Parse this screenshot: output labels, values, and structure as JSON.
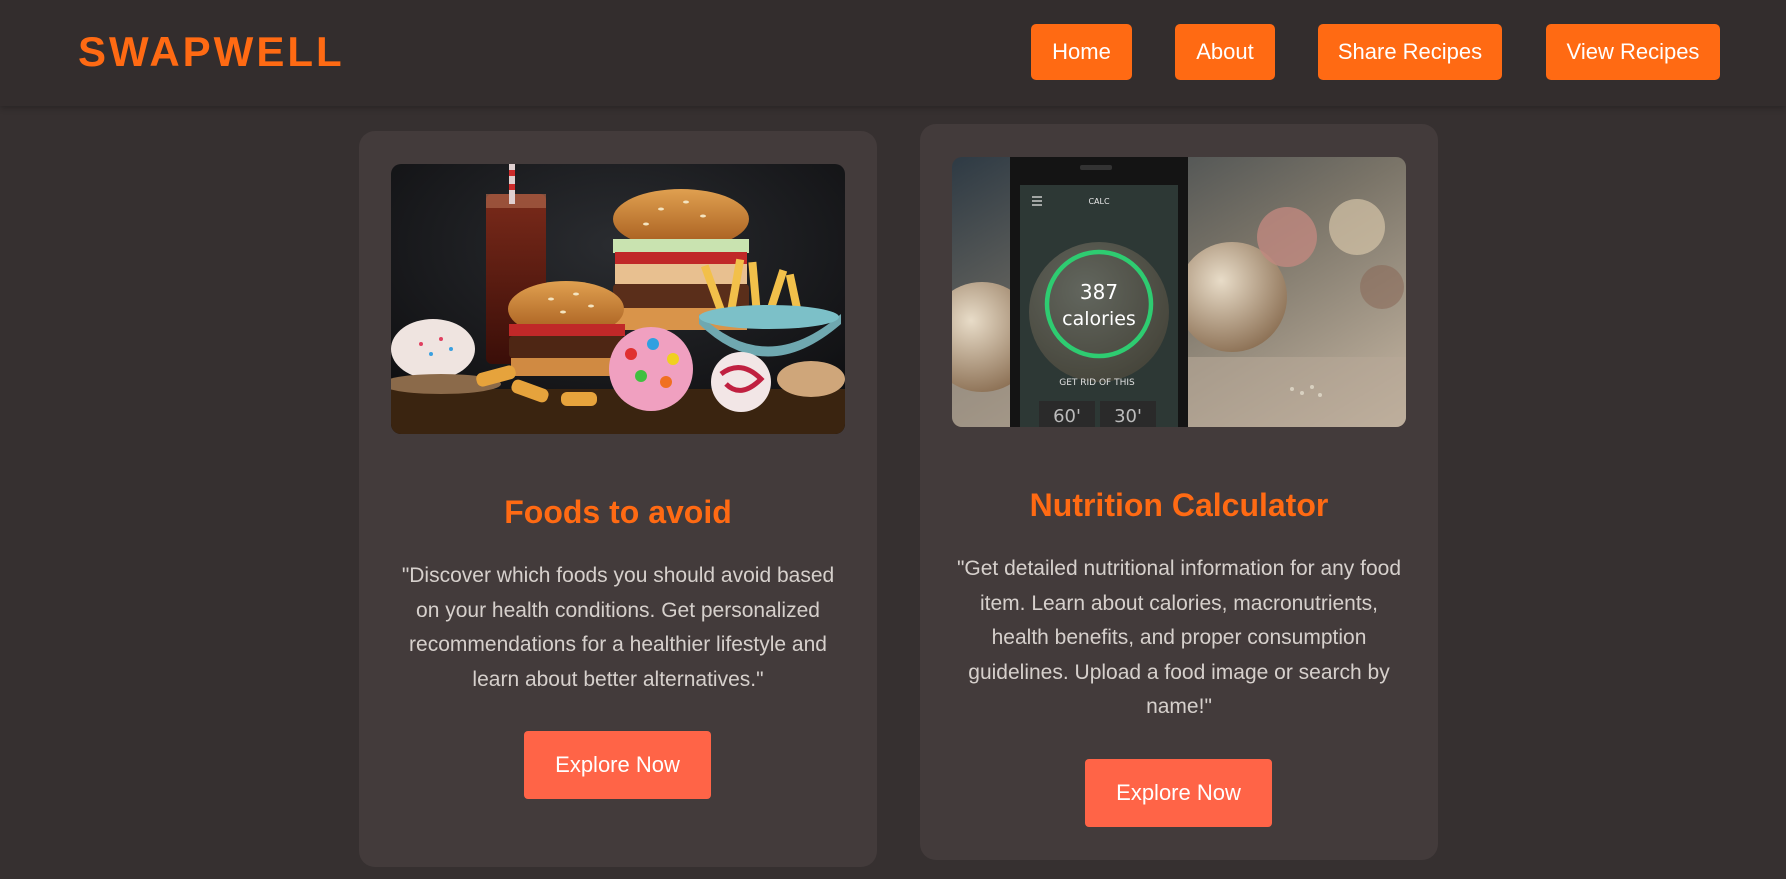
{
  "header": {
    "logo": "SWAPWELL",
    "nav": [
      {
        "label": "Home"
      },
      {
        "label": "About"
      },
      {
        "label": "Share Recipes"
      },
      {
        "label": "View Recipes"
      }
    ]
  },
  "cards": [
    {
      "title": "Foods to avoid",
      "description": "\"Discover which foods you should avoid based on your health conditions. Get personalized recommendations for a healthier lifestyle and learn about better alternatives.\"",
      "button": "Explore Now",
      "image_label": "junk food spread"
    },
    {
      "title": "Nutrition Calculator",
      "description": "\"Get detailed nutritional information for any food item. Learn about calories, macronutrients, health benefits, and proper consumption guidelines. Upload a food image or search by name!\"",
      "button": "Explore Now",
      "image_label": "calorie app on phone",
      "phone_screen": {
        "app_title": "CALC",
        "calorie_value": "387",
        "calorie_unit": "calories",
        "caption": "GET RID OF THIS",
        "timer_a": "60'",
        "timer_b": "30'"
      }
    }
  ],
  "colors": {
    "accent": "#ff6a13",
    "button": "#ff6447",
    "background": "#363030",
    "card": "#433b3b"
  }
}
